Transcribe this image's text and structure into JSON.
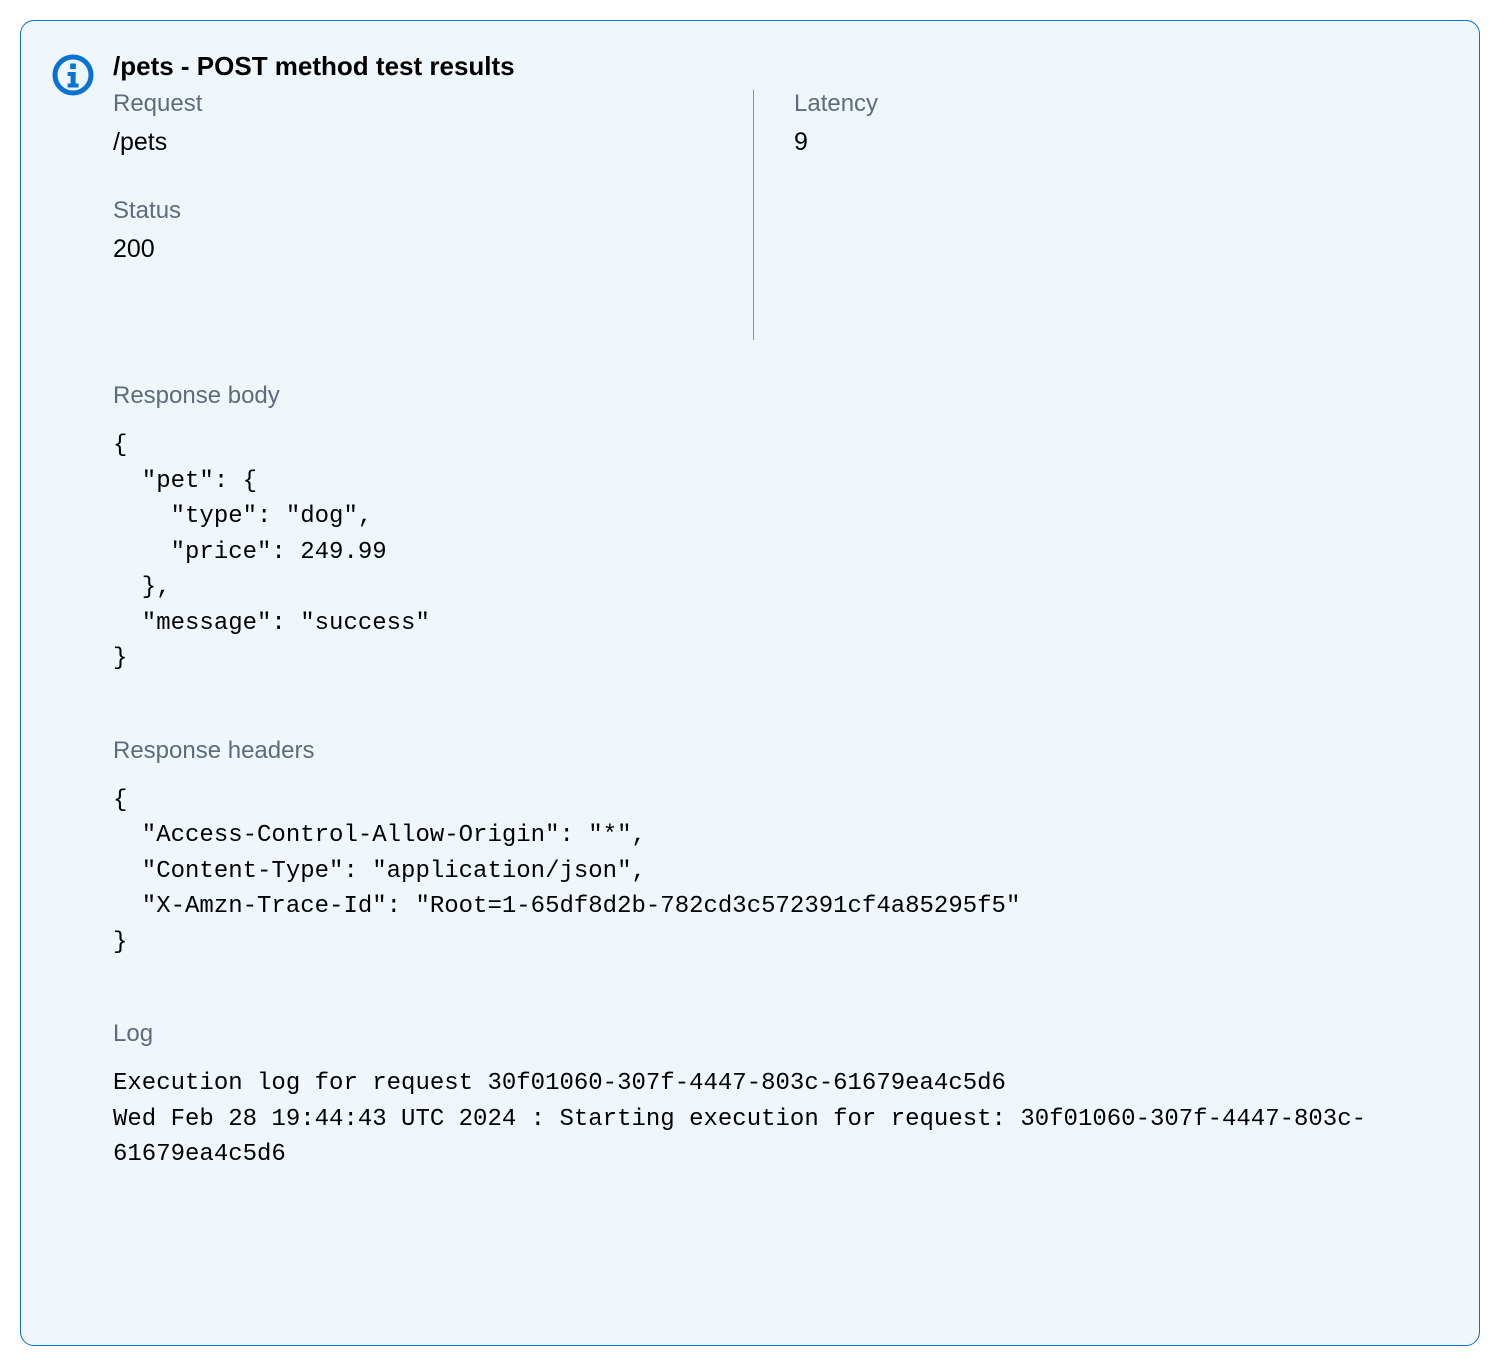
{
  "title": "/pets - POST method test results",
  "meta": {
    "request_label": "Request",
    "request_value": "/pets",
    "latency_label": "Latency",
    "latency_value": "9",
    "status_label": "Status",
    "status_value": "200"
  },
  "response_body_label": "Response body",
  "response_body": "{\n  \"pet\": {\n    \"type\": \"dog\",\n    \"price\": 249.99\n  },\n  \"message\": \"success\"\n}",
  "response_headers_label": "Response headers",
  "response_headers": "{\n  \"Access-Control-Allow-Origin\": \"*\",\n  \"Content-Type\": \"application/json\",\n  \"X-Amzn-Trace-Id\": \"Root=1-65df8d2b-782cd3c572391cf4a85295f5\"\n}",
  "log_label": "Log",
  "log": "Execution log for request 30f01060-307f-4447-803c-61679ea4c5d6\nWed Feb 28 19:44:43 UTC 2024 : Starting execution for request: 30f01060-307f-4447-803c-61679ea4c5d6"
}
